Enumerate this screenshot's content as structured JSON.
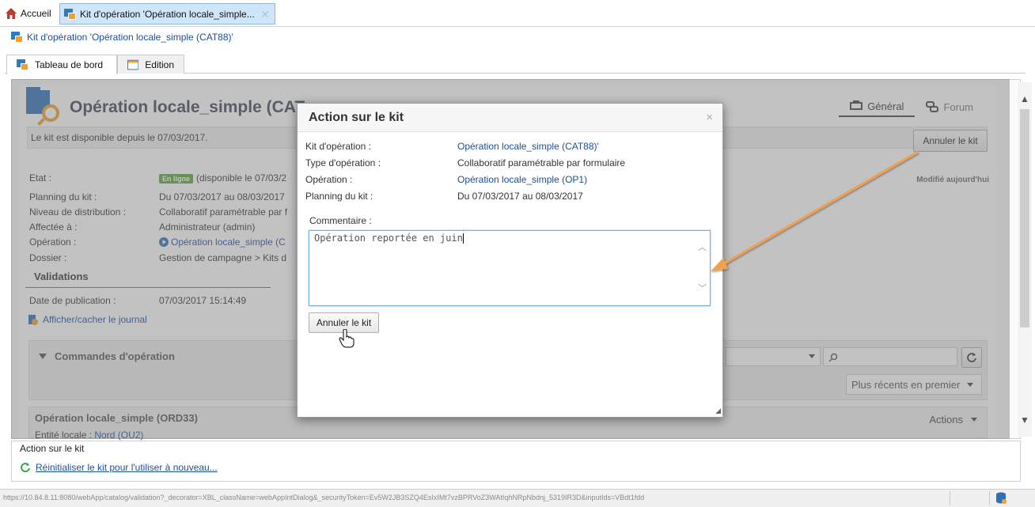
{
  "topbar": {
    "home_label": "Accueil",
    "tab_label": "Kit d'opération 'Opération locale_simple...",
    "tab_close": "✕"
  },
  "breadcrumb": {
    "label": "Kit d'opération 'Opération locale_simple (CAT88)'"
  },
  "subtabs": [
    {
      "label": "Tableau de bord"
    },
    {
      "label": "Edition"
    }
  ],
  "main": {
    "title": "Opération locale_simple (CAT",
    "tab_general": "Général",
    "tab_forum": "Forum",
    "info_text": "Le kit est disponible depuis le 07/03/2017.",
    "annuler_button": "Annuler le kit",
    "modified": "Modifié aujourd'hui",
    "props": {
      "etat_label": "Etat :",
      "etat_badge": "En ligne",
      "etat_value": "(disponible le 07/03/2",
      "planning_label": "Planning du kit :",
      "planning_value": "Du 07/03/2017 au 08/03/2017",
      "niveau_label": "Niveau de distribution :",
      "niveau_value": "Collaboratif paramétrable par f",
      "affectee_label": "Affectée à :",
      "affectee_value": "Administrateur (admin)",
      "operation_label": "Opération :",
      "operation_value": "Opération locale_simple (C",
      "dossier_label": "Dossier :",
      "dossier_value": "Gestion de campagne > Kits d"
    },
    "validations_heading": "Validations",
    "date_pub_label": "Date de publication :",
    "date_pub_value": "07/03/2017 15:14:49",
    "journal_link": "Afficher/cacher le journal",
    "commandes_heading": "Commandes d'opération",
    "sort_select": "Plus récents en premier",
    "order_title": "Opération locale_simple (ORD33)",
    "order_entite_label": "Entité locale :",
    "order_entite_value": "Nord (OU2)",
    "actions_label": "Actions"
  },
  "bottom": {
    "title": "Action sur le kit",
    "link": "Réinitialiser le kit pour l'utiliser à nouveau..."
  },
  "status": {
    "url": "https://10.84.8.11:8080/webApp/catalog/validation?_decorator=XBL_className=webAppIntDialog&_securityToken=Ev5W2JB3SZQ4EsIxIMt7vzBPRVoZ3WAtIqhNRpNbdnj_5319IR3D&inputIds=VBdt1fdd"
  },
  "modal": {
    "title": "Action sur le kit",
    "close": "×",
    "rows": [
      {
        "label": "Kit d'opération :",
        "value": "Opération locale_simple (CAT88)'"
      },
      {
        "label": "Type d'opération :",
        "value": "Collaboratif paramétrable par formulaire"
      },
      {
        "label": "Opération :",
        "value": "Opération locale_simple (OP1)"
      },
      {
        "label": "Planning du kit :",
        "value": "Du 07/03/2017 au 08/03/2017"
      }
    ],
    "comment_label": "Commentaire :",
    "comment_value": "Opération reportée en juin",
    "button": "Annuler le kit"
  },
  "colors": {
    "accent": "#1a4fa0",
    "badge_green": "#5aa839",
    "arrow_orange": "#f0a050"
  }
}
